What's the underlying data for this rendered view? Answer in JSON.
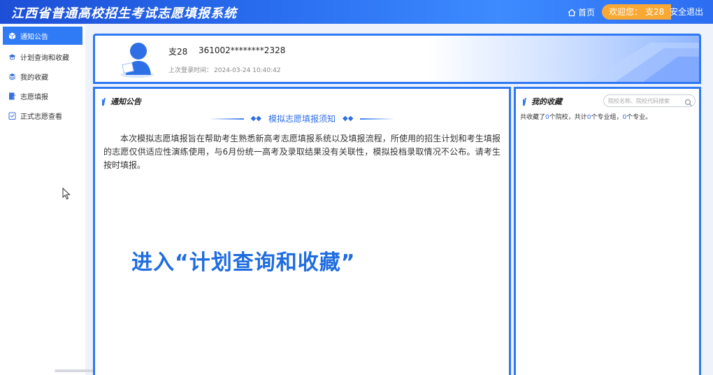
{
  "header": {
    "title": "江西省普通高校招生考试志愿填报系统",
    "home_label": "首页",
    "welcome_label": "欢迎您：",
    "username": "支28",
    "logout_label": "安全退出"
  },
  "sidebar": {
    "items": [
      {
        "label": "通知公告",
        "icon": "cube-icon",
        "active": true
      },
      {
        "label": "计划查询和收藏",
        "icon": "grad-cap-icon",
        "active": false
      },
      {
        "label": "我的收藏",
        "icon": "layers-icon",
        "active": false
      },
      {
        "label": "志愿填报",
        "icon": "edit-doc-icon",
        "active": false
      },
      {
        "label": "正式志愿查看",
        "icon": "checklist-icon",
        "active": false
      }
    ]
  },
  "profile": {
    "name": "支28",
    "id_number": "361002********2328",
    "last_login_label": "上次登录时间：",
    "last_login_time": "2024-03-24 10:40:42"
  },
  "notice": {
    "section_label": "通知公告",
    "title": "模拟志愿填报须知",
    "body": "本次模拟志愿填报旨在帮助考生熟悉新高考志愿填报系统以及填报流程，所使用的招生计划和考生填报的志愿仅供适应性演练使用，与6月份统一高考及录取结果没有关联性，模拟投档录取情况不公布。请考生按时填报。"
  },
  "favorites": {
    "section_label": "我的收藏",
    "search_placeholder": "院校名称、院校代码搜索",
    "summary_prefix": "共收藏了",
    "school_count": "0",
    "summary_mid1": "个院校，共计",
    "group_count": "0",
    "summary_mid2": "个专业组，",
    "major_count": "0",
    "summary_suffix": "个专业。"
  },
  "overlay": {
    "caption": "进入“计划查询和收藏”"
  },
  "colors": {
    "primary": "#2f78f4",
    "accent": "#f8a833"
  }
}
